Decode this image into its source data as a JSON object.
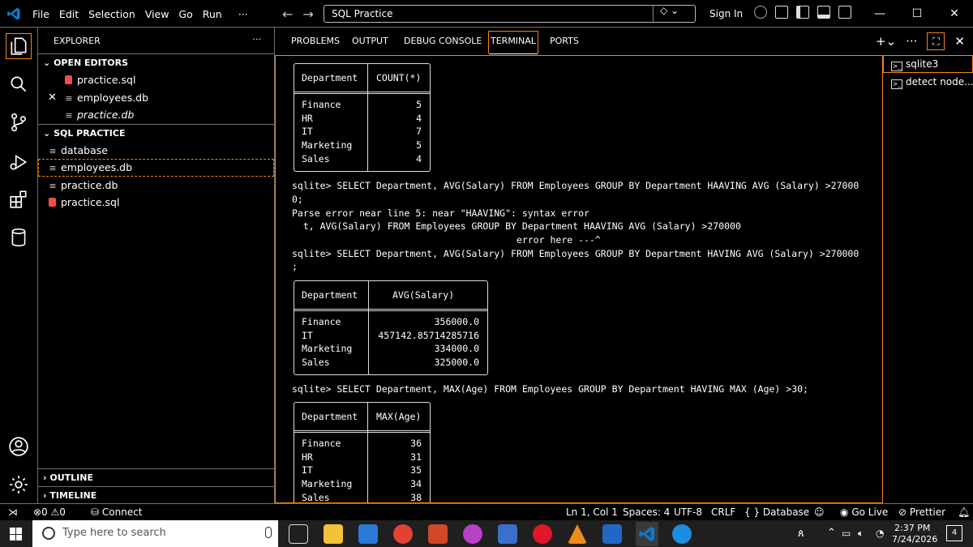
{
  "titlebar": {
    "menu": [
      "File",
      "Edit",
      "Selection",
      "View",
      "Go",
      "Run",
      "···"
    ],
    "search_text": "SQL Practice",
    "sign_in": "Sign In",
    "minimize": "—",
    "maximize": "☐",
    "close": "✕"
  },
  "sidebar": {
    "title": "EXPLORER",
    "more": "···",
    "open_editors_label": "OPEN EDITORS",
    "open_editors": [
      {
        "name": "practice.sql"
      },
      {
        "name": "employees.db"
      },
      {
        "name": "practice.db"
      }
    ],
    "folder_label": "SQL PRACTICE",
    "files": [
      {
        "name": "database"
      },
      {
        "name": "employees.db"
      },
      {
        "name": "practice.db"
      },
      {
        "name": "practice.sql"
      }
    ],
    "outline_label": "OUTLINE",
    "timeline_label": "TIMELINE"
  },
  "panel": {
    "tabs": [
      "PROBLEMS",
      "OUTPUT",
      "DEBUG CONSOLE",
      "TERMINAL",
      "PORTS"
    ],
    "active_tab": "TERMINAL"
  },
  "terminal": {
    "table1": {
      "headers": [
        "Department",
        "COUNT(*)"
      ],
      "rows": [
        [
          "Finance",
          "5"
        ],
        [
          "HR",
          "4"
        ],
        [
          "IT",
          "7"
        ],
        [
          "Marketing",
          "5"
        ],
        [
          "Sales",
          "4"
        ]
      ]
    },
    "lines_a": [
      "sqlite> SELECT Department, AVG(Salary) FROM Employees GROUP BY Department HAAVING AVG (Salary) >27000",
      "0;",
      "Parse error near line 5: near \"HAAVING\": syntax error",
      "  t, AVG(Salary) FROM Employees GROUP BY Department HAAVING AVG (Salary) >270000",
      "                                        error here ---^",
      "sqlite> SELECT Department, AVG(Salary) FROM Employees GROUP BY Department HAVING AVG (Salary) >270000",
      ";"
    ],
    "table2": {
      "headers": [
        "Department",
        "AVG(Salary)"
      ],
      "rows": [
        [
          "Finance",
          "356000.0"
        ],
        [
          "IT",
          "457142.85714285716"
        ],
        [
          "Marketing",
          "334000.0"
        ],
        [
          "Sales",
          "325000.0"
        ]
      ]
    },
    "line_b": "sqlite> SELECT Department, MAX(Age) FROM Employees GROUP BY Department HAVING MAX (Age) >30;",
    "table3": {
      "headers": [
        "Department",
        "MAX(Age)"
      ],
      "rows": [
        [
          "Finance",
          "36"
        ],
        [
          "HR",
          "31"
        ],
        [
          "IT",
          "35"
        ],
        [
          "Marketing",
          "34"
        ],
        [
          "Sales",
          "38"
        ]
      ]
    }
  },
  "terminal_list": [
    {
      "name": "sqlite3"
    },
    {
      "name": "detect node..."
    }
  ],
  "statusbar": {
    "errors": "0",
    "warnings": "0",
    "connect": "Connect",
    "position": "Ln 1, Col 1",
    "spaces": "Spaces: 4",
    "encoding": "UTF-8",
    "eol": "CRLF",
    "language": "Database",
    "go_live": "Go Live",
    "prettier": "Prettier"
  },
  "taskbar": {
    "search_placeholder": "Type here to search",
    "time": "2:37 PM",
    "date": "7/24/2026",
    "notifications": "4"
  },
  "colors": {
    "accent": "#f38518",
    "sql_icon": "#f14c4c",
    "vscode_blue": "#0a7acc"
  }
}
